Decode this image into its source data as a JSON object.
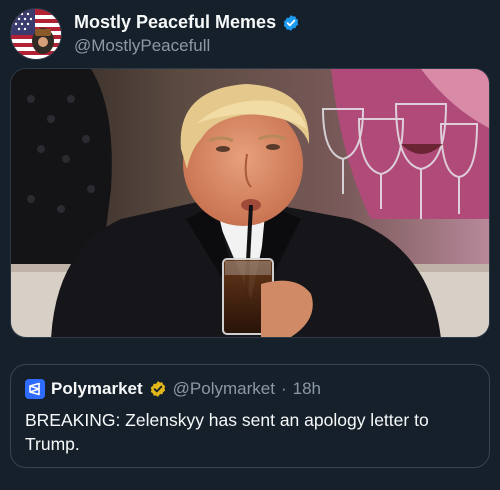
{
  "post": {
    "author": {
      "display_name": "Mostly Peaceful Memes",
      "handle": "@MostlyPeacefull",
      "verified": true,
      "avatar_icon": "flag-avatar-icon",
      "verified_icon": "verified-badge-icon"
    },
    "media": {
      "kind": "photo",
      "icon": "photo-man-drinking-through-straw"
    },
    "quoted": {
      "display_name": "Polymarket",
      "handle": "@Polymarket",
      "separator": "·",
      "time": "18h",
      "verified": true,
      "logo_icon": "polymarket-logo-icon",
      "text": "BREAKING: Zelenskyy has sent an apology letter to Trump."
    }
  },
  "colors": {
    "background": "#15202b",
    "text_primary": "#f7f9f9",
    "text_secondary": "#8b98a5",
    "verified_blue": "#1d9bf0",
    "gold_badge": "#e2b719",
    "border": "#38444d"
  }
}
